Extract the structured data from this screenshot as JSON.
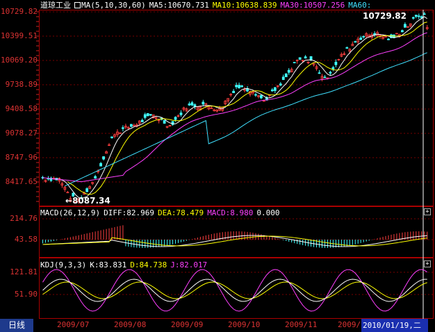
{
  "title": "道琼工业",
  "main_legend": {
    "ma_label": "MA(5,10,30,60)",
    "ma5": "MA5:10670.731",
    "ma10": "MA10:10638.839",
    "ma30": "MA30:10507.256",
    "ma60": "MA60:"
  },
  "macd_legend": {
    "label": "MACD(26,12,9)",
    "diff": "DIFF:82.969",
    "dea": "DEA:78.479",
    "macd": "MACD:8.980",
    "extra": "0.000"
  },
  "kdj_legend": {
    "label": "KDJ(9,3,3)",
    "k": "K:83.831",
    "d": "D:84.738",
    "j": "J:82.017"
  },
  "price_axis": [
    "10729.82",
    "10399.51",
    "10069.20",
    "9738.89",
    "9408.58",
    "9078.27",
    "8747.96",
    "8417.65"
  ],
  "macd_axis": [
    "214.76",
    "43.58"
  ],
  "kdj_axis": [
    "121.81",
    "51.90"
  ],
  "x_labels": [
    "2009/07",
    "2009/08",
    "2009/09",
    "2009/10",
    "2009/11",
    "2009/12"
  ],
  "high_marker": "10729.82",
  "low_marker": "8087.34",
  "period_tab": "日线",
  "current_date": "2010/01/19,二",
  "colors": {
    "up": "#ff4040",
    "down": "#40ffff",
    "ma5": "#ffffff",
    "ma10": "#ffff00",
    "ma30": "#ff40ff",
    "ma60": "#40e0ff",
    "axis": "#cc2222"
  }
}
